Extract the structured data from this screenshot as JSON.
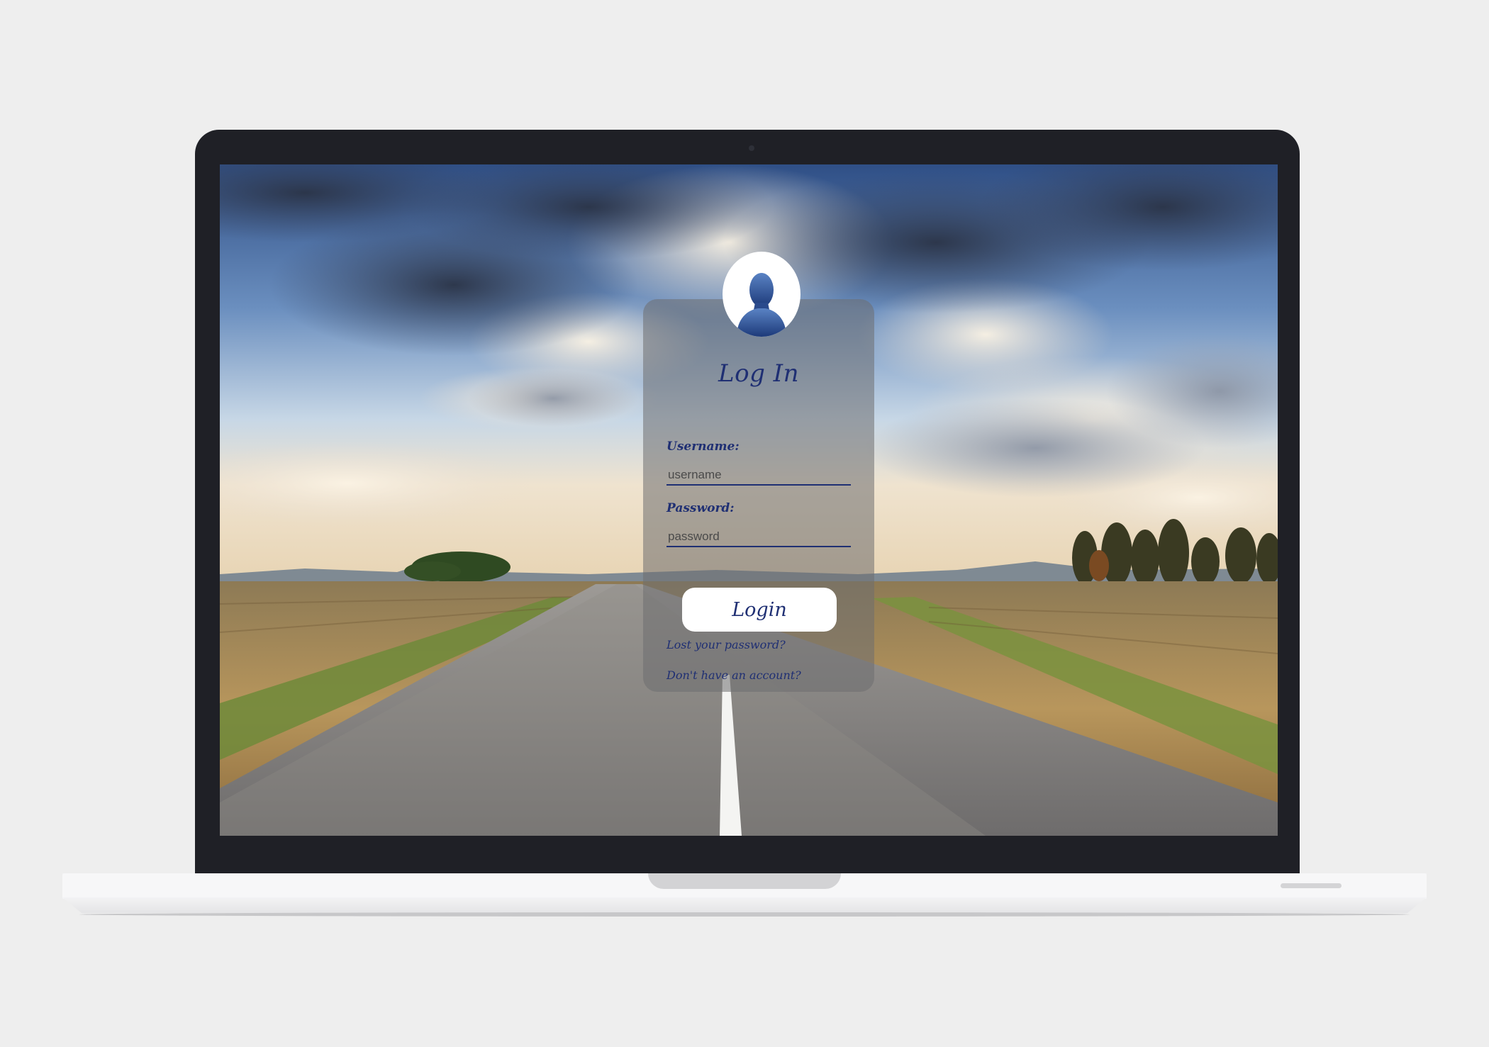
{
  "login": {
    "title": "Log In",
    "username_label": "Username:",
    "username_placeholder": "username",
    "username_value": "",
    "password_label": "Password:",
    "password_placeholder": "password",
    "password_value": "",
    "button_label": "Login",
    "lost_password_link": "Lost your password?",
    "signup_link": "Don't have an account?"
  },
  "icons": {
    "avatar": "user-avatar-icon"
  },
  "colors": {
    "accent": "#1f2f73",
    "card": "#6e6e70",
    "button": "#ffffff",
    "laptop_frame": "#1f2026",
    "page_background": "#eeeeee"
  }
}
